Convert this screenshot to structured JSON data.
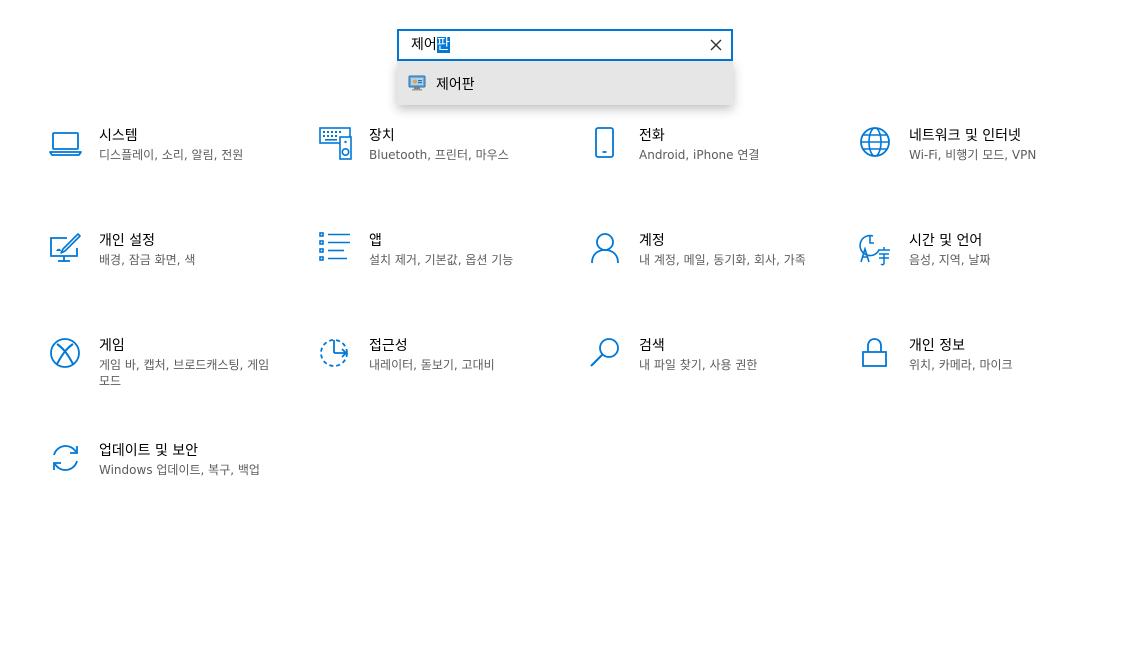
{
  "search": {
    "value_typed": "제어",
    "value_selected": "판",
    "clear_icon": "close-icon"
  },
  "suggestions": [
    {
      "label": "제어판",
      "icon": "control-panel-icon"
    }
  ],
  "tiles": [
    {
      "title": "시스템",
      "desc": "디스플레이, 소리, 알림, 전원",
      "icon": "laptop-icon"
    },
    {
      "title": "장치",
      "desc": "Bluetooth, 프린터, 마우스",
      "icon": "devices-icon"
    },
    {
      "title": "전화",
      "desc": "Android, iPhone 연결",
      "icon": "phone-icon"
    },
    {
      "title": "네트워크 및 인터넷",
      "desc": "Wi-Fi, 비행기 모드, VPN",
      "icon": "globe-icon"
    },
    {
      "title": "개인 설정",
      "desc": "배경, 잠금 화면, 색",
      "icon": "personalization-icon"
    },
    {
      "title": "앱",
      "desc": "설치 제거, 기본값, 옵션 기능",
      "icon": "apps-list-icon"
    },
    {
      "title": "계정",
      "desc": "내 계정, 메일, 동기화, 회사, 가족",
      "icon": "person-icon"
    },
    {
      "title": "시간 및 언어",
      "desc": "음성, 지역, 날짜",
      "icon": "time-language-icon"
    },
    {
      "title": "게임",
      "desc": "게임 바, 캡처, 브로드캐스팅, 게임 모드",
      "icon": "xbox-icon"
    },
    {
      "title": "접근성",
      "desc": "내레이터, 돋보기, 고대비",
      "icon": "ease-of-access-icon"
    },
    {
      "title": "검색",
      "desc": "내 파일 찾기, 사용 권한",
      "icon": "search-icon"
    },
    {
      "title": "개인 정보",
      "desc": "위치, 카메라, 마이크",
      "icon": "lock-icon"
    },
    {
      "title": "업데이트 및 보안",
      "desc": "Windows 업데이트, 복구, 백업",
      "icon": "sync-icon"
    }
  ],
  "colors": {
    "accent": "#0078d7",
    "description": "#5c5c5c",
    "dropdown_bg": "#e6e6e6"
  }
}
